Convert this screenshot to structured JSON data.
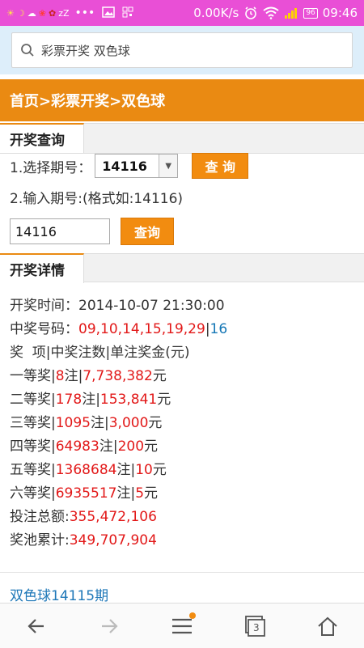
{
  "status_bar": {
    "network_speed": "0.00K/s",
    "battery": "96",
    "time": "09:46",
    "left_icons": [
      "weather-icon",
      "moon-icon",
      "cloud-icon",
      "flower-icon",
      "notification-icon",
      "sleep-icon"
    ],
    "dots": "•••"
  },
  "search": {
    "text": "彩票开奖 双色球"
  },
  "breadcrumb": {
    "text": "首页>彩票开奖>双色球"
  },
  "query_section": {
    "tab_label": "开奖查询",
    "select_label": "1.选择期号：",
    "select_value": "14116",
    "query_button": "查 询",
    "input_label": "2.输入期号:(格式如:14116)",
    "input_value": "14116",
    "query_button2": "查询"
  },
  "details_section": {
    "tab_label": "开奖详情",
    "draw_time_label": "开奖时间：",
    "draw_time": "2014-10-07 21:30:00",
    "numbers_label": "中奖号码：",
    "red_numbers": "09,10,14,15,19,29",
    "separator": "|",
    "blue_number": "16",
    "table_header": "奖  项|中奖注数|单注奖金(元)",
    "prizes": [
      {
        "name": "一等奖",
        "count": "8",
        "amount": "7,738,382"
      },
      {
        "name": "二等奖",
        "count": "178",
        "amount": "153,841"
      },
      {
        "name": "三等奖",
        "count": "1095",
        "amount": "3,000"
      },
      {
        "name": "四等奖",
        "count": "64983",
        "amount": "200"
      },
      {
        "name": "五等奖",
        "count": "1368684",
        "amount": "10"
      },
      {
        "name": "六等奖",
        "count": "6935517",
        "amount": "5"
      }
    ],
    "zhu": "注",
    "yuan": "元",
    "total_bet_label": "投注总额:",
    "total_bet": "355,472,106",
    "pool_label": "奖池累计:",
    "pool": "349,707,904"
  },
  "next_link": "双色球14115期",
  "bottom_nav": {
    "tab_count": "3"
  },
  "colors": {
    "accent": "#f28c10",
    "status_bar": "#e94fd6",
    "red": "#e21818",
    "blue": "#1577b6"
  }
}
